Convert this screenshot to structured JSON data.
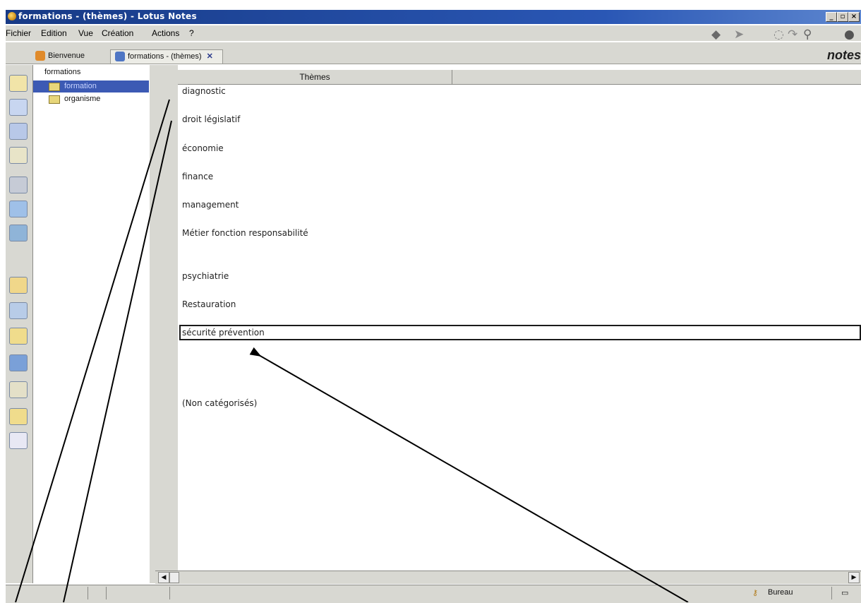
{
  "window": {
    "title": "formations - (thèmes) - Lotus Notes"
  },
  "menu": {
    "items": [
      {
        "label": "Fichier"
      },
      {
        "label": "Edition"
      },
      {
        "label": "Vue"
      },
      {
        "label": "Création"
      },
      {
        "label": "Actions"
      },
      {
        "label": "?"
      }
    ]
  },
  "tabs": {
    "home_label": "Bienvenue",
    "doc_label": "formations - (thèmes)"
  },
  "brand": "notes",
  "navigator": {
    "root": "formations",
    "items": [
      {
        "label": "formation",
        "selected": true
      },
      {
        "label": "organisme",
        "selected": false
      }
    ]
  },
  "view": {
    "column_header": "Thèmes",
    "rows": [
      "diagnostic",
      "droit législatif",
      "économie",
      "finance",
      "management",
      "Métier fonction responsabilité",
      "psychiatrie",
      "Restauration",
      "sécurité prévention",
      "(Non catégorisés)"
    ],
    "selected_row": "sécurité prévention"
  },
  "status": {
    "location": "Bureau"
  },
  "colors": {
    "title_bar": "#1f3d86",
    "chrome": "#d8d8d2",
    "selection": "#3c5ab4"
  }
}
